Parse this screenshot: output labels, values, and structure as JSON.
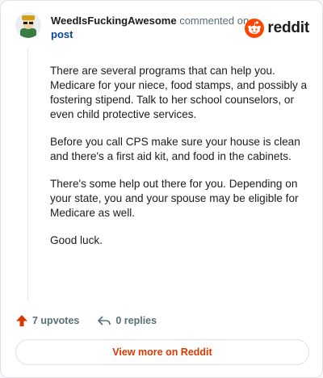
{
  "comment": {
    "username": "WeedIsFuckingAwesome",
    "action_text": "commented on",
    "target_text": "post",
    "paragraphs": [
      "There are several programs that can help you. Medicare for your niece, food stamps, and possibly a fostering stipend. Talk to her school counselors, or even child protective services.",
      "Before you call CPS make sure your house is clean and there's a first aid kit, and food in the cabinets.",
      "There's some help out there for you. Depending on your state, you and your spouse may be eligible for Medicare as well.",
      "Good luck."
    ]
  },
  "brand": {
    "wordmark": "reddit",
    "color": "#ff4500"
  },
  "actions": {
    "upvotes_label": "7 upvotes",
    "replies_label": "0 replies"
  },
  "footer": {
    "view_more_label": "View more on Reddit",
    "accent": "#d93900"
  },
  "icons": {
    "avatar": "user-avatar",
    "brand": "reddit-logo-icon",
    "upvote": "upvote-arrow-icon",
    "reply": "reply-arrow-icon"
  }
}
